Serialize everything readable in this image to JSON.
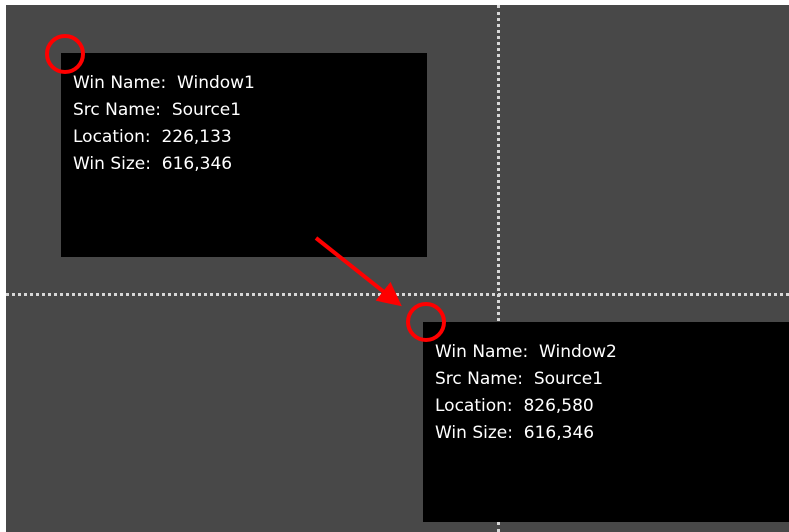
{
  "windows": [
    {
      "win_name_label": "Win Name:",
      "win_name": "Window1",
      "src_name_label": "Src Name:",
      "src_name": "Source1",
      "location_label": "Location:",
      "location": "226,133",
      "win_size_label": "Win Size:",
      "win_size": "616,346"
    },
    {
      "win_name_label": "Win Name:",
      "win_name": "Window2",
      "src_name_label": "Src Name:",
      "src_name": "Source1",
      "location_label": "Location:",
      "location": "826,580",
      "win_size_label": "Win Size:",
      "win_size": "616,346"
    }
  ],
  "colors": {
    "canvas_background": "#484848",
    "window_background": "#000000",
    "guide_line": "#d8d8d8",
    "annotation_red": "#ff0000",
    "text": "#ffffff"
  },
  "icons": {
    "corner_marker": "red-circle-marker",
    "move_indicator": "red-arrow"
  }
}
